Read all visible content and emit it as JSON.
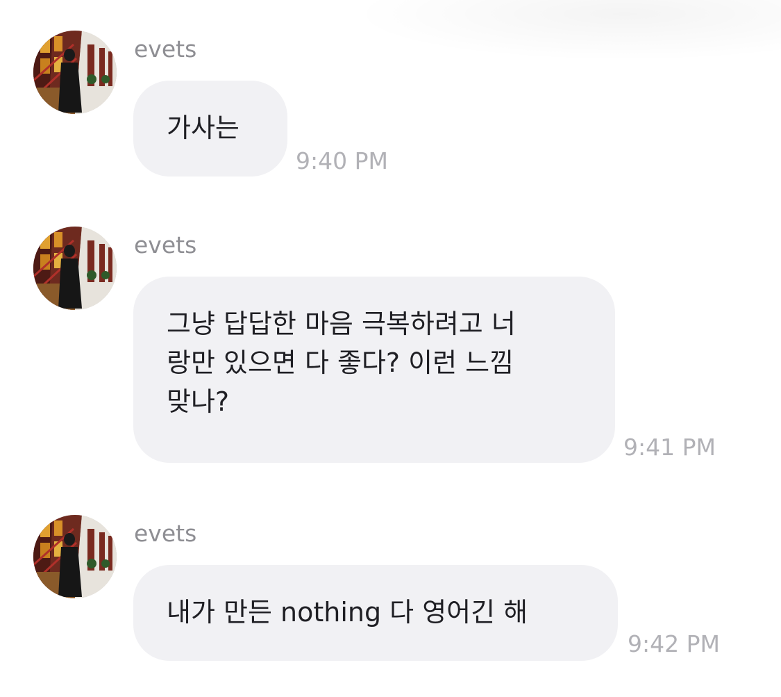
{
  "chat": {
    "icons": {
      "avatar": "profile-photo-person-standing-by-red-building"
    },
    "messages": [
      {
        "sender": "evets",
        "text": "가사는",
        "time": "9:40 PM"
      },
      {
        "sender": "evets",
        "text": "그냥 답답한 마음 극복하려고 너\n랑만 있으면 다 좋다? 이런 느낌\n맞나?",
        "time": "9:41 PM"
      },
      {
        "sender": "evets",
        "text": "내가 만든 nothing 다 영어긴 해",
        "time": "9:42 PM"
      }
    ],
    "colors": {
      "bubble_background": "#f1f1f4",
      "message_text": "#1f1f24",
      "sender_text": "#8e8e93",
      "timestamp_text": "#b1b1b6"
    }
  }
}
